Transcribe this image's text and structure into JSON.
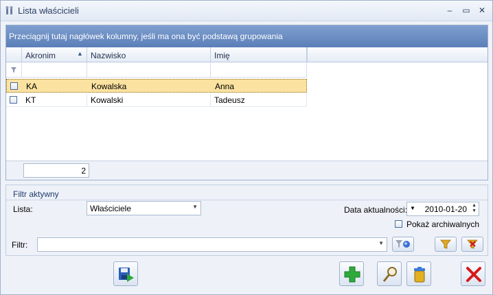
{
  "window": {
    "title": "Lista właścicieli"
  },
  "title_buttons": {
    "minimize": "–",
    "maximize": "▭",
    "close": "✕"
  },
  "grid": {
    "group_hint": "Przeciągnij tutaj nagłówek kolumny, jeśli ma ona być podstawą grupowania",
    "columns": [
      {
        "label": "Akronim",
        "sort": "ascending"
      },
      {
        "label": "Nazwisko"
      },
      {
        "label": "Imię"
      }
    ],
    "rows": [
      {
        "akronim": "KA",
        "nazwisko": "Kowalska",
        "imie": "Anna",
        "selected": true
      },
      {
        "akronim": "KT",
        "nazwisko": "Kowalski",
        "imie": "Tadeusz",
        "selected": false
      }
    ],
    "sort_indicator": "▲",
    "row_count": "2"
  },
  "filter": {
    "title": "Filtr aktywny",
    "lista_label": "Lista:",
    "lista_value": "Właściciele",
    "date_label": "Data aktualności:",
    "date_value": "2010-01-20",
    "archive_label": "Pokaż archiwalnych",
    "filter_label": "Filtr:",
    "filter_value": ""
  },
  "colors": {
    "header_gradient_top": "#7f9fcf",
    "header_gradient_bottom": "#5a7eb8",
    "selected_row": "#fbe2a0"
  },
  "icons": [
    "save-icon",
    "add-icon",
    "magnifier-icon",
    "trash-icon",
    "close-icon",
    "funnel-icon",
    "clear-filter-icon"
  ]
}
